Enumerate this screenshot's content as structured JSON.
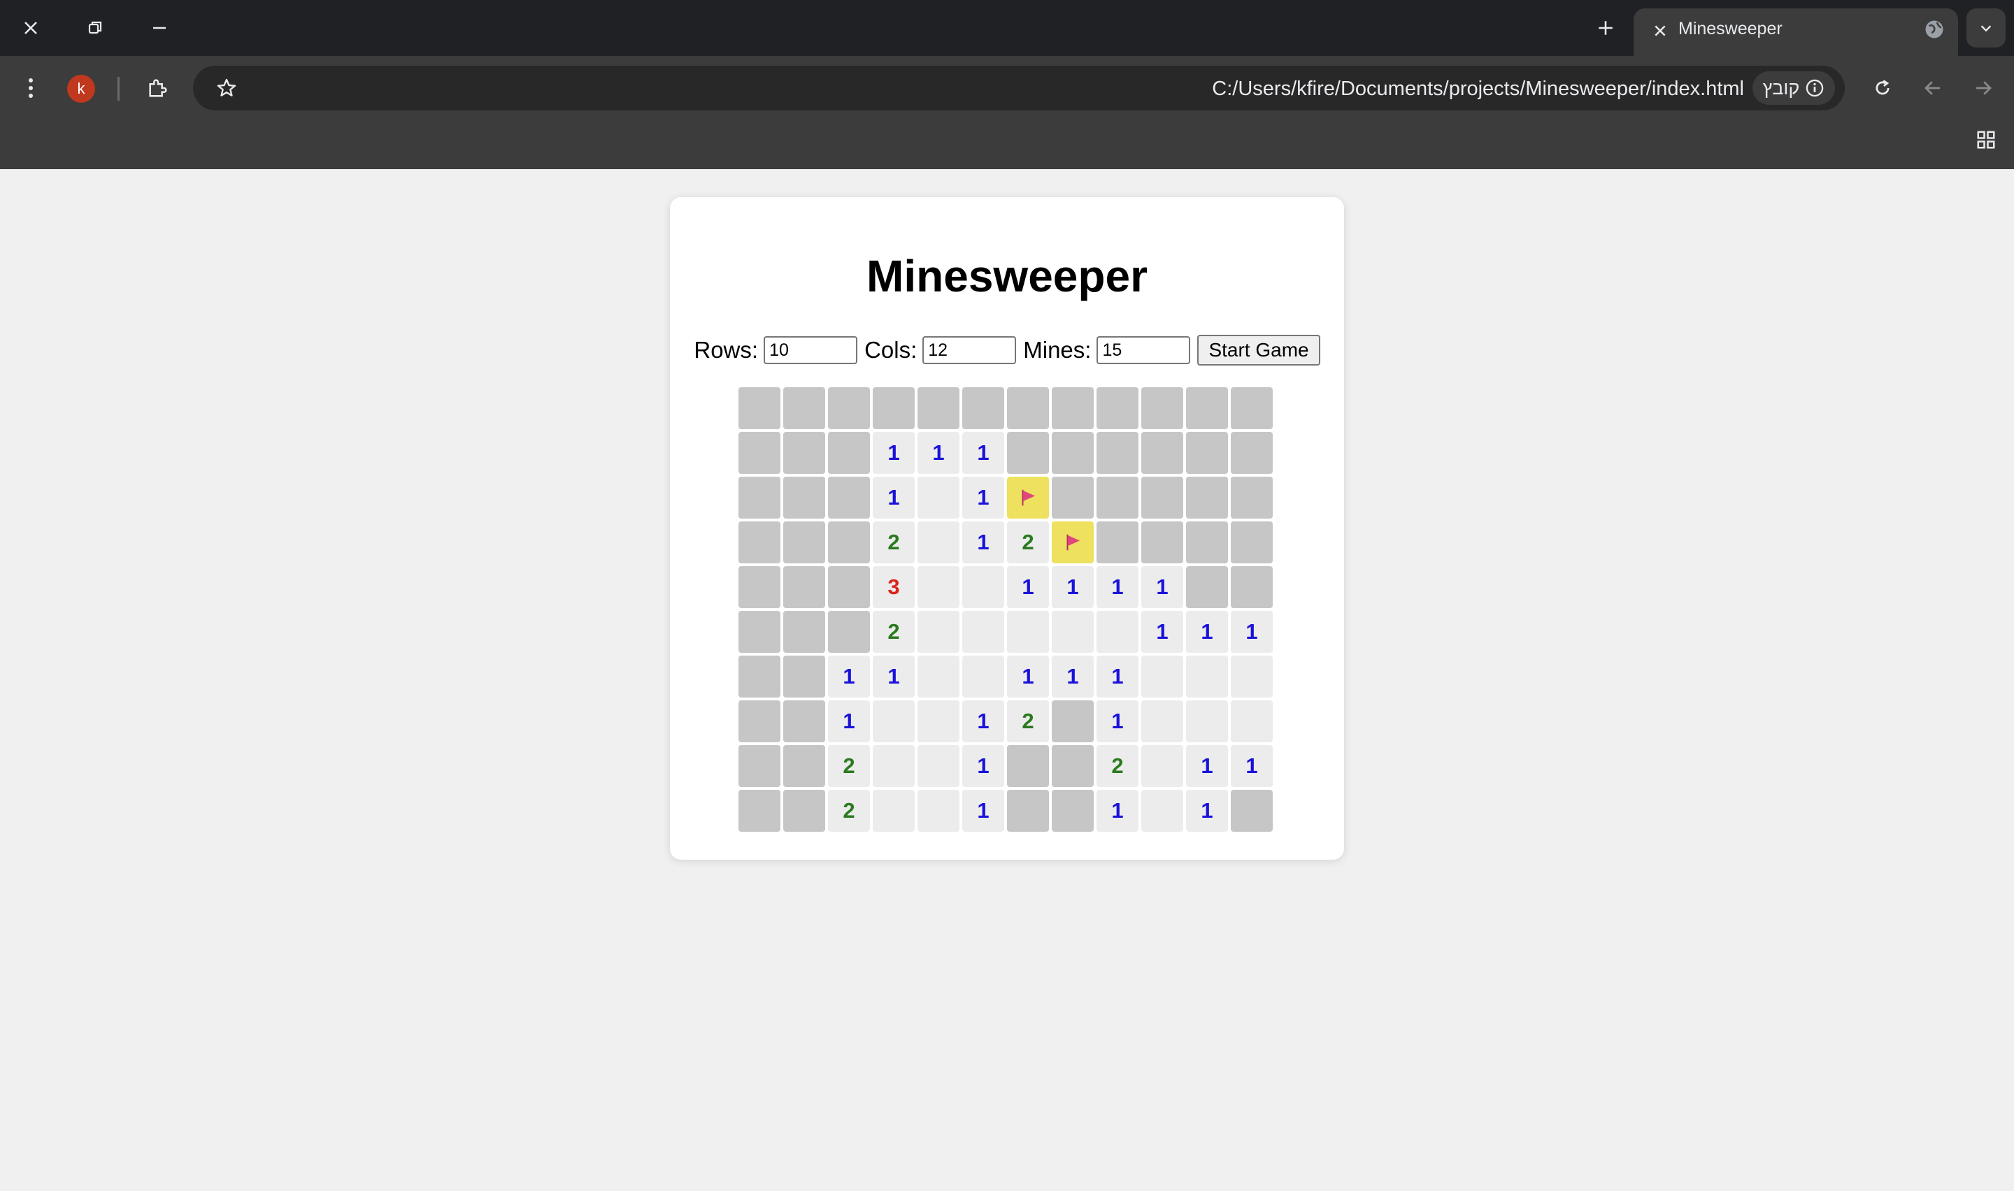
{
  "browser": {
    "tab_title": "Minesweeper",
    "url": "C:/Users/kfire/Documents/projects/Minesweeper/index.html",
    "site_chip_label": "קובץ",
    "profile_initial": "k",
    "icons": [
      "close-icon",
      "restore-icon",
      "minimize-icon",
      "new-tab-icon",
      "tab-close-icon",
      "globe-icon",
      "chevron-down-icon",
      "menu-dots-icon",
      "extensions-icon",
      "star-icon",
      "info-icon",
      "reload-icon",
      "back-icon",
      "forward-icon",
      "apps-grid-icon"
    ]
  },
  "page": {
    "title": "Minesweeper",
    "rows_label": "Rows:",
    "rows_value": "10",
    "cols_label": "Cols:",
    "cols_value": "12",
    "mines_label": "Mines:",
    "mines_value": "15",
    "start_button": "Start Game"
  },
  "board": {
    "rows": 10,
    "cols": 12,
    "legend": "H = hidden, E = open empty, F = flagged, digits = open with number",
    "grid": [
      [
        "H",
        "H",
        "H",
        "H",
        "H",
        "H",
        "H",
        "H",
        "H",
        "H",
        "H",
        "H"
      ],
      [
        "H",
        "H",
        "H",
        "1",
        "1",
        "1",
        "H",
        "H",
        "H",
        "H",
        "H",
        "H"
      ],
      [
        "H",
        "H",
        "H",
        "1",
        "E",
        "1",
        "F",
        "H",
        "H",
        "H",
        "H",
        "H"
      ],
      [
        "H",
        "H",
        "H",
        "2",
        "E",
        "1",
        "2",
        "F",
        "H",
        "H",
        "H",
        "H"
      ],
      [
        "H",
        "H",
        "H",
        "3",
        "E",
        "E",
        "1",
        "1",
        "1",
        "1",
        "H",
        "H"
      ],
      [
        "H",
        "H",
        "H",
        "2",
        "E",
        "E",
        "E",
        "E",
        "E",
        "1",
        "1",
        "1"
      ],
      [
        "H",
        "H",
        "1",
        "1",
        "E",
        "E",
        "1",
        "1",
        "1",
        "E",
        "E",
        "E"
      ],
      [
        "H",
        "H",
        "1",
        "E",
        "E",
        "1",
        "2",
        "H",
        "1",
        "E",
        "E",
        "E"
      ],
      [
        "H",
        "H",
        "2",
        "E",
        "E",
        "1",
        "H",
        "H",
        "2",
        "E",
        "1",
        "1"
      ],
      [
        "H",
        "H",
        "2",
        "E",
        "E",
        "1",
        "H",
        "H",
        "1",
        "E",
        "1",
        "H"
      ]
    ]
  },
  "colors": {
    "hidden_cell": "#c6c6c6",
    "open_cell": "#ececec",
    "flag_cell": "#ede15f",
    "flag": "#e0457b",
    "one": "#1a12d9",
    "two": "#2a7a1e",
    "three": "#d9251d"
  }
}
